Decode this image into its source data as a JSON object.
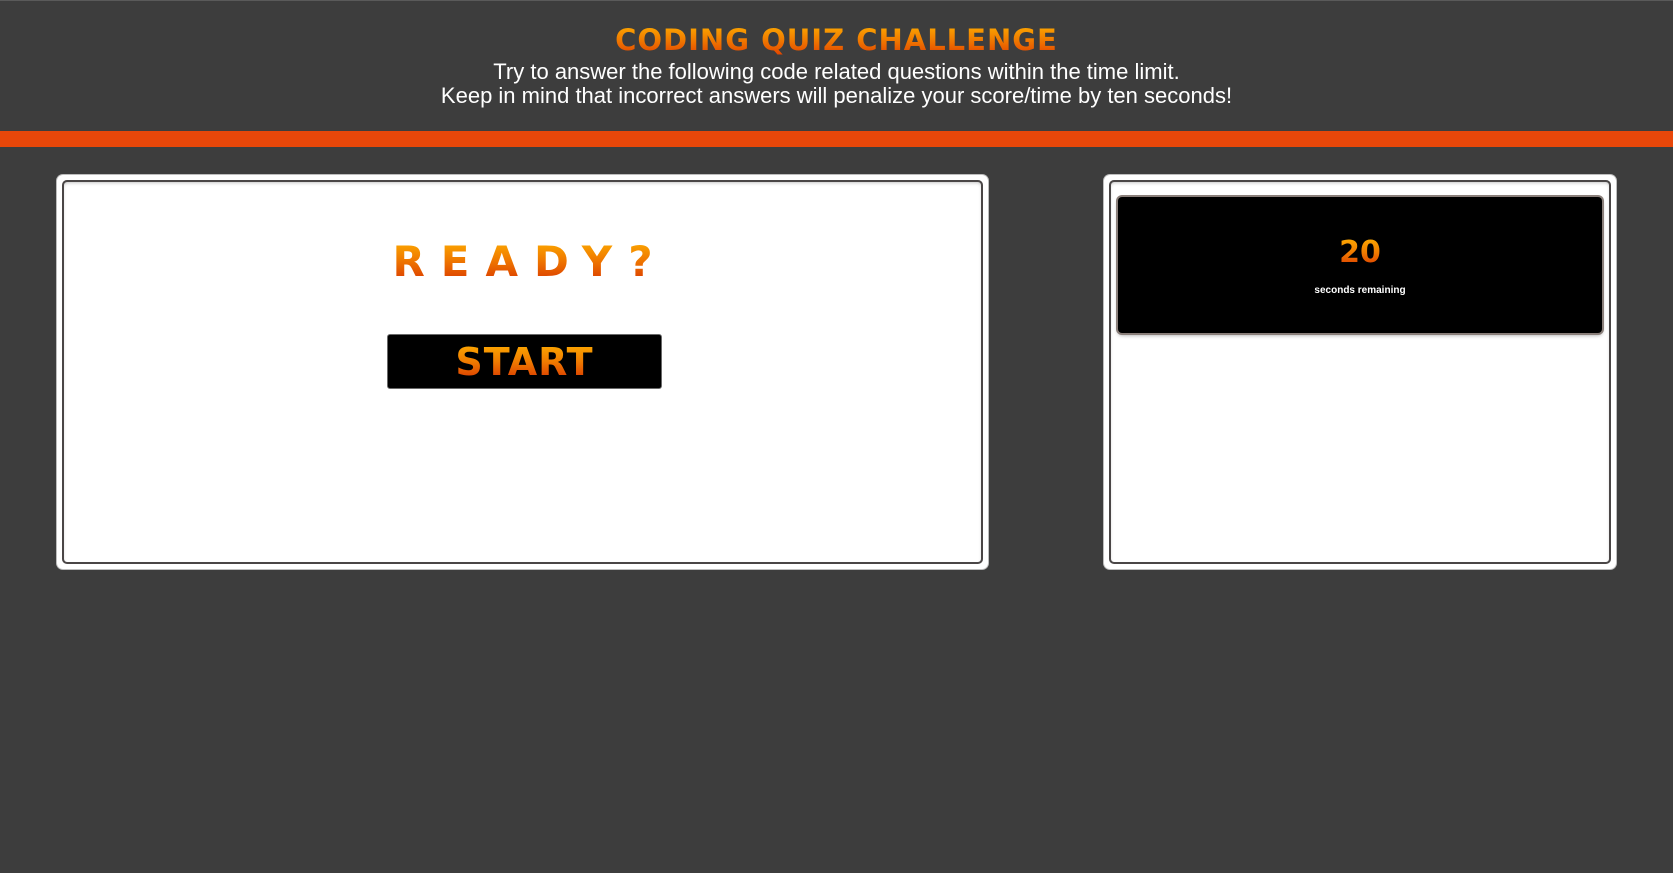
{
  "header": {
    "title": "CODING QUIZ CHALLENGE",
    "subtitle_line1": "Try to answer the following code related questions within the time limit.",
    "subtitle_line2": "Keep in mind that incorrect answers will penalize your score/time by ten seconds!"
  },
  "quiz": {
    "prompt": "READY?",
    "start_label": "START"
  },
  "timer": {
    "value": "20",
    "label": "seconds remaining"
  },
  "colors": {
    "background": "#3d3d3d",
    "accent_bar": "#e8470a",
    "title_gradient_top": "#ffb300",
    "title_gradient_bottom": "#d42a00",
    "panel": "#ffffff",
    "timer_box": "#000000"
  }
}
